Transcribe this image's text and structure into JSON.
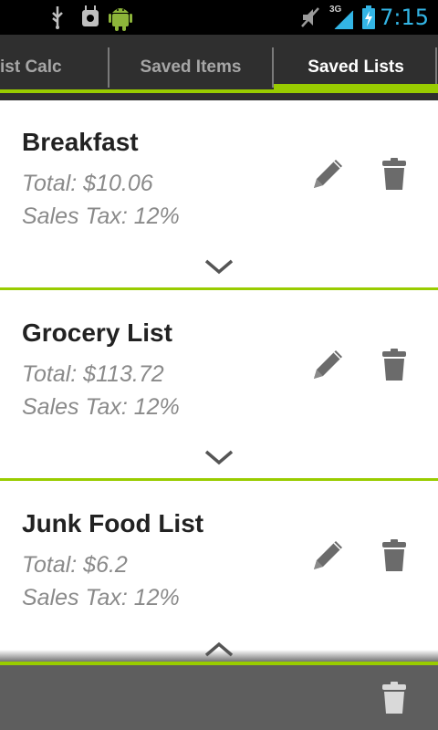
{
  "status_bar": {
    "time": "7:15",
    "network_label": "3G",
    "icons": [
      "usb-icon",
      "android-debug-icon",
      "android-app-icon",
      "mute-icon",
      "signal-icon",
      "battery-charging-icon"
    ],
    "time_color": "#33b5e5"
  },
  "tabs": [
    {
      "label": "ist Calc",
      "active": false
    },
    {
      "label": "Saved Items",
      "active": false
    },
    {
      "label": "Saved Lists",
      "active": true
    }
  ],
  "accent_color": "#99cc00",
  "saved_lists": [
    {
      "name": "Breakfast",
      "total": "Total: $10.06",
      "sales_tax": "Sales Tax: 12%",
      "expanded": false
    },
    {
      "name": "Grocery List",
      "total": "Total: $113.72",
      "sales_tax": "Sales Tax: 12%",
      "expanded": false
    },
    {
      "name": "Junk Food List",
      "total": "Total: $6.2",
      "sales_tax": "Sales Tax: 12%",
      "expanded": true
    }
  ],
  "list_actions": {
    "edit_icon": "pencil-icon",
    "delete_icon": "trash-icon"
  },
  "bottom_bar": {
    "action_icon": "trash-icon"
  }
}
